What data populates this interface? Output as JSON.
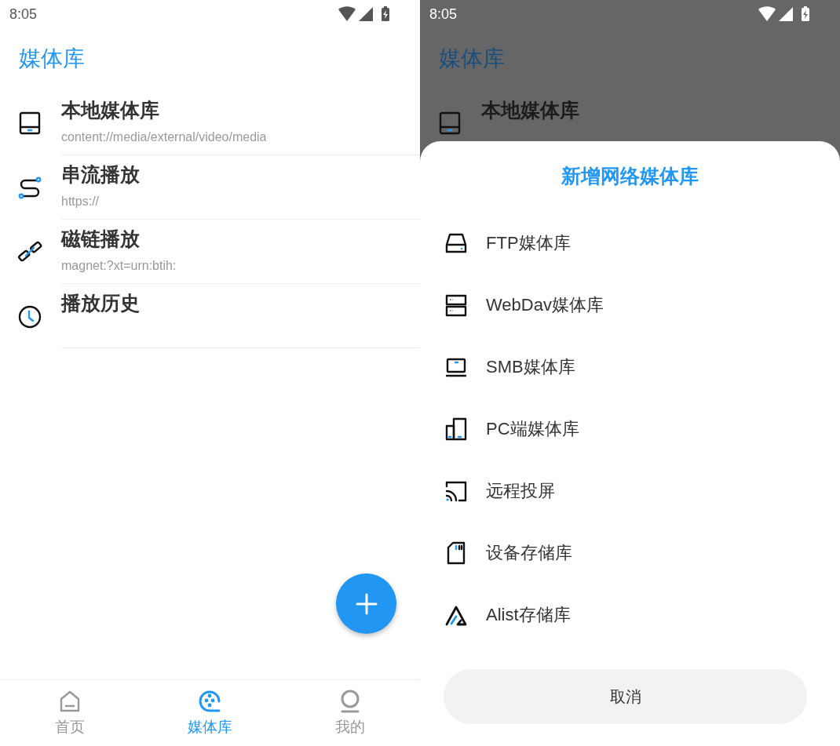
{
  "screens": [
    {
      "dimmed": false,
      "status_bar": {
        "time": "8:05"
      },
      "title": "媒体库",
      "items": [
        {
          "title": "本地媒体库",
          "subtitle": "content://media/external/video/media"
        },
        {
          "title": "串流播放",
          "subtitle": "https://"
        },
        {
          "title": "磁链播放",
          "subtitle": "magnet:?xt=urn:btih:"
        },
        {
          "title": "播放历史"
        }
      ],
      "fab": {
        "visible": true
      },
      "bottom_nav": [
        {
          "label": "首页",
          "selected": false
        },
        {
          "label": "媒体库",
          "selected": true
        },
        {
          "label": "我的",
          "selected": false
        }
      ]
    },
    {
      "dimmed": true,
      "status_bar": {
        "time": "8:05"
      },
      "title": "媒体库",
      "items": [
        {
          "title": "本地媒体库"
        }
      ],
      "sheet": {
        "title": "新增网络媒体库",
        "options": [
          {
            "label": "FTP媒体库"
          },
          {
            "label": "WebDav媒体库"
          },
          {
            "label": "SMB媒体库"
          },
          {
            "label": "PC端媒体库"
          },
          {
            "label": "远程投屏"
          },
          {
            "label": "设备存储库"
          },
          {
            "label": "Alist存储库"
          }
        ],
        "cancel": "取消"
      }
    }
  ]
}
